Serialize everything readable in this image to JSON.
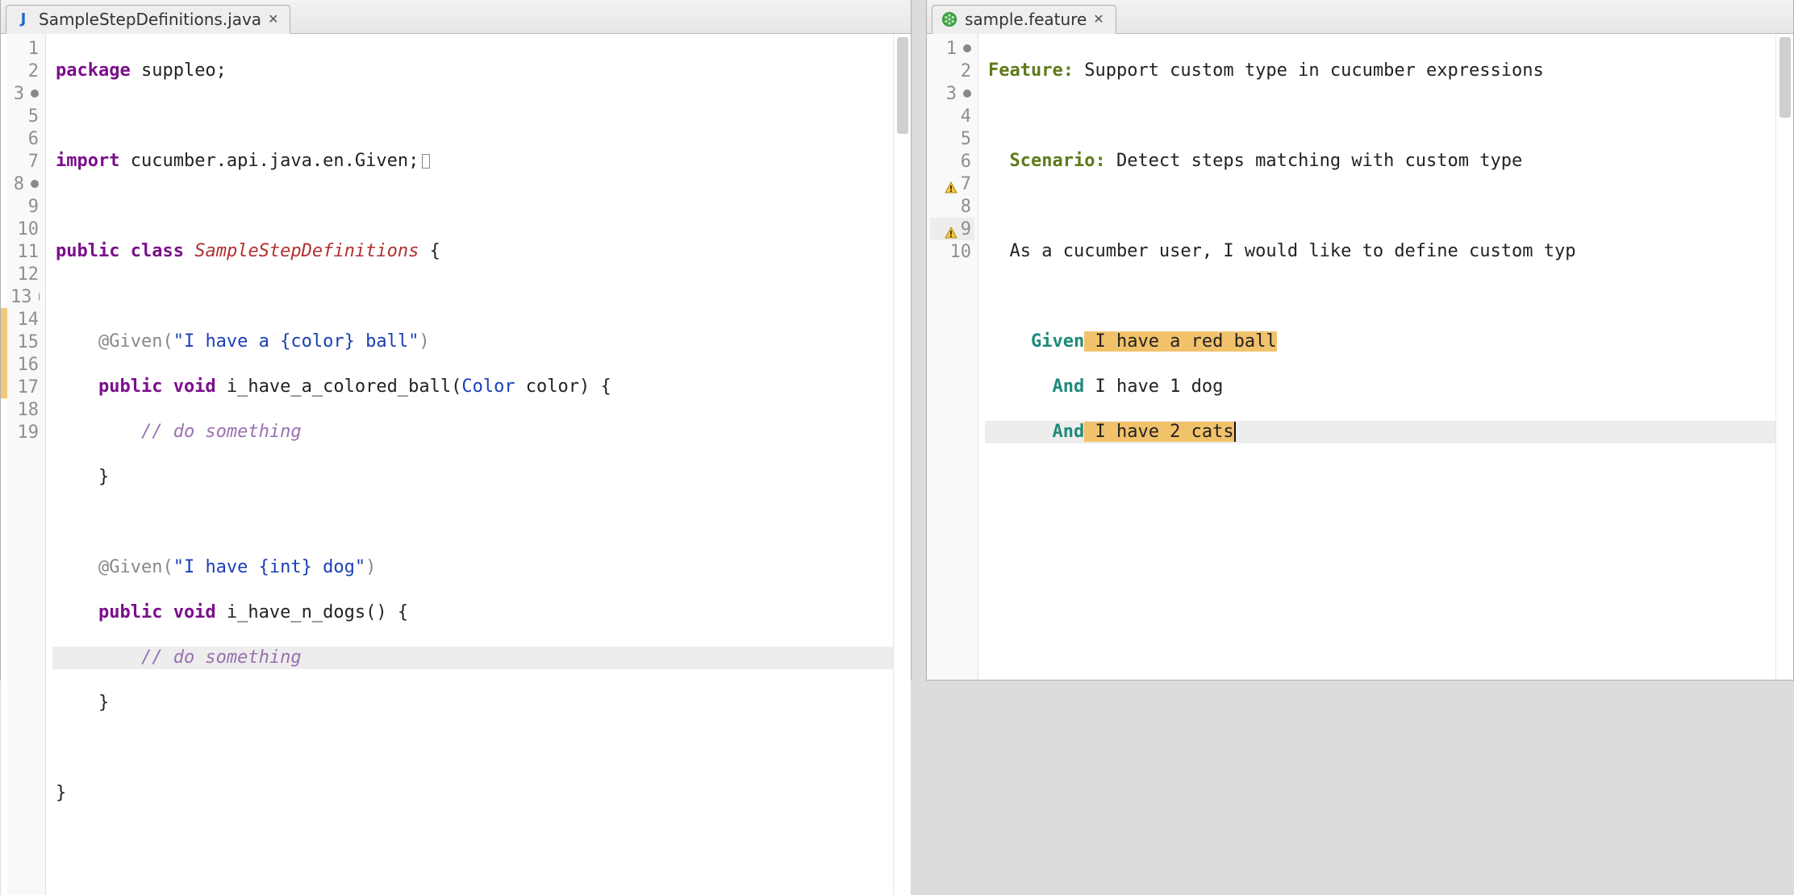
{
  "left": {
    "tab": {
      "filename": "SampleStepDefinitions.java",
      "icon": "J"
    },
    "gutter_labels": [
      "1",
      "2",
      "3",
      "5",
      "6",
      "7",
      "8",
      "9",
      "10",
      "11",
      "12",
      "13",
      "14",
      "15",
      "16",
      "17",
      "18",
      "19"
    ],
    "fold_markers_at": [
      "3",
      "8",
      "13"
    ],
    "dirty_range_start": 13,
    "dirty_range_end": 16,
    "code": {
      "l1_kw_package": "package",
      "l1_pkg": " suppleo;",
      "l3_kw_import": "import",
      "l3_path": " cucumber.api.java.en.Given;",
      "l6_kw_public": "public",
      "l6_kw_class": "class",
      "l6_class": "SampleStepDefinitions",
      "l6_brace": " {",
      "l8_ann": "    @Given(",
      "l8_str": "\"I have a {color} ball\"",
      "l8_close": ")",
      "l9_kw": "    public void",
      "l9_name": " i_have_a_colored_ball(",
      "l9_type": "Color",
      "l9_param": " color) {",
      "l10_comment": "        // do something",
      "l11": "    }",
      "l13_ann": "    @Given(",
      "l13_str": "\"I have {int} dog\"",
      "l13_close": ")",
      "l14_kw": "    public void",
      "l14_name": " i_have_n_dogs() {",
      "l15_comment": "        // do something",
      "l16": "    }",
      "l18": "}"
    }
  },
  "right": {
    "tab": {
      "filename": "sample.feature"
    },
    "gutter_labels": [
      "1",
      "2",
      "3",
      "4",
      "5",
      "6",
      "7",
      "8",
      "9",
      "10"
    ],
    "fold_markers_at": [
      "1",
      "3"
    ],
    "warnings_at": [
      "7",
      "9"
    ],
    "code": {
      "l1_kw": "Feature:",
      "l1_txt": " Support custom type in cucumber expressions",
      "l3_kw": "  Scenario:",
      "l3_txt": " Detect steps matching with custom type",
      "l5_txt": "  As a cucumber user, I would like to define custom typ",
      "l7_kw": "    Given",
      "l7_hl": " I have a red ball",
      "l8_kw": "      And",
      "l8_txt": " I have 1 dog",
      "l9_kw": "      And",
      "l9_hl": " I have 2 cats"
    }
  }
}
